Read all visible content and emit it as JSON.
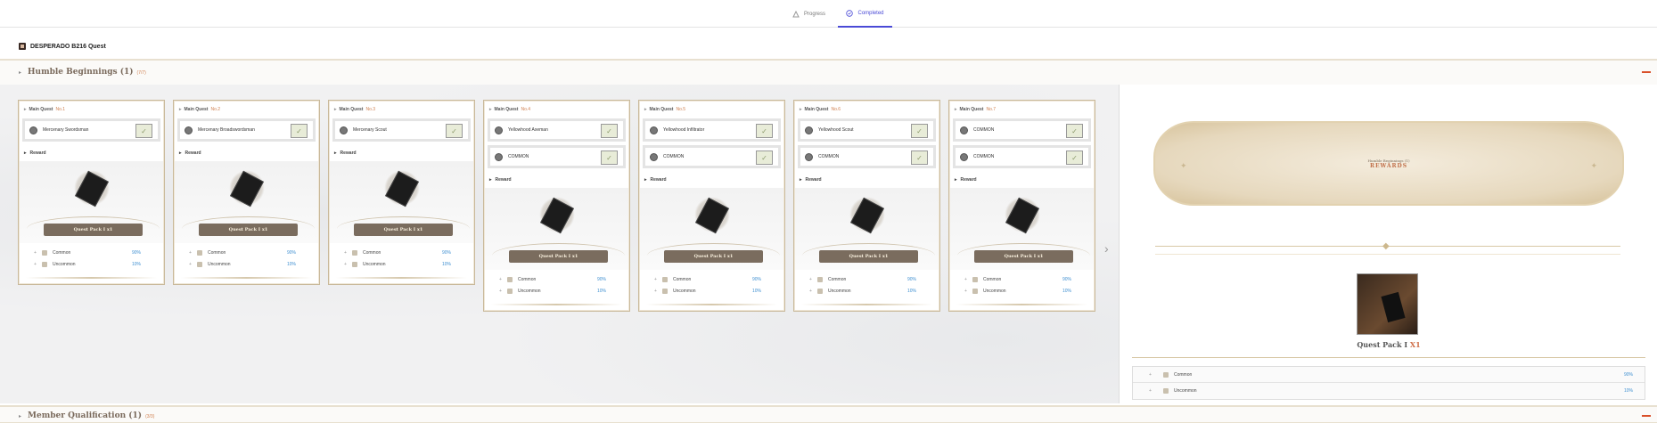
{
  "tabs": [
    {
      "label": "Progress",
      "active": false
    },
    {
      "label": "Completed",
      "active": true
    }
  ],
  "quest_title": "DESPERADO B216 Quest",
  "section1": {
    "title": "Humble Beginnings (1)",
    "count": "(7/7)"
  },
  "section2": {
    "title": "Member Qualification (1)",
    "count": "(3/3)"
  },
  "cards": [
    {
      "mq": "Main Quest",
      "no": "No.1",
      "tasks": [
        "Mercenary Swordsman"
      ],
      "reward": "Reward",
      "pack": "Quest Pack I x1",
      "drops": [
        {
          "name": "Common",
          "pct": "90%"
        },
        {
          "name": "Uncommon",
          "pct": "10%"
        }
      ]
    },
    {
      "mq": "Main Quest",
      "no": "No.2",
      "tasks": [
        "Mercenary Broadswordsman"
      ],
      "reward": "Reward",
      "pack": "Quest Pack I x1",
      "drops": [
        {
          "name": "Common",
          "pct": "90%"
        },
        {
          "name": "Uncommon",
          "pct": "10%"
        }
      ]
    },
    {
      "mq": "Main Quest",
      "no": "No.3",
      "tasks": [
        "Mercenary Scout"
      ],
      "reward": "Reward",
      "pack": "Quest Pack I x1",
      "drops": [
        {
          "name": "Common",
          "pct": "90%"
        },
        {
          "name": "Uncommon",
          "pct": "10%"
        }
      ]
    },
    {
      "mq": "Main Quest",
      "no": "No.4",
      "tasks": [
        "Yellowhood Axeman",
        "COMMON"
      ],
      "reward": "Reward",
      "pack": "Quest Pack I x1",
      "drops": [
        {
          "name": "Common",
          "pct": "90%"
        },
        {
          "name": "Uncommon",
          "pct": "10%"
        }
      ]
    },
    {
      "mq": "Main Quest",
      "no": "No.5",
      "tasks": [
        "Yellowhood Infiltrator",
        "COMMON"
      ],
      "reward": "Reward",
      "pack": "Quest Pack I x1",
      "drops": [
        {
          "name": "Common",
          "pct": "90%"
        },
        {
          "name": "Uncommon",
          "pct": "10%"
        }
      ]
    },
    {
      "mq": "Main Quest",
      "no": "No.6",
      "tasks": [
        "Yellowhood Scout",
        "COMMON"
      ],
      "reward": "Reward",
      "pack": "Quest Pack I x1",
      "drops": [
        {
          "name": "Common",
          "pct": "90%"
        },
        {
          "name": "Uncommon",
          "pct": "10%"
        }
      ]
    },
    {
      "mq": "Main Quest",
      "no": "No.7",
      "tasks": [
        "COMMON",
        "COMMON"
      ],
      "reward": "Reward",
      "pack": "Quest Pack I x1",
      "drops": [
        {
          "name": "Common",
          "pct": "90%"
        },
        {
          "name": "Uncommon",
          "pct": "10%"
        }
      ]
    }
  ],
  "rewards_panel": {
    "plaque_title": "Humble Beginnings (1)",
    "plaque_label": "REWARDS",
    "item_name": "Quest Pack I",
    "item_qty": "X1",
    "drops": [
      {
        "name": "Common",
        "pct": "90%"
      },
      {
        "name": "Uncommon",
        "pct": "10%"
      }
    ]
  },
  "colors": {
    "accent": "#4a4ad6",
    "highlight": "#d08050",
    "percent": "#3e8fd1"
  },
  "icons": {
    "progress": "progress-icon",
    "completed": "check-circle-icon",
    "next": "chevron-right-icon",
    "collapse": "minus-icon"
  }
}
